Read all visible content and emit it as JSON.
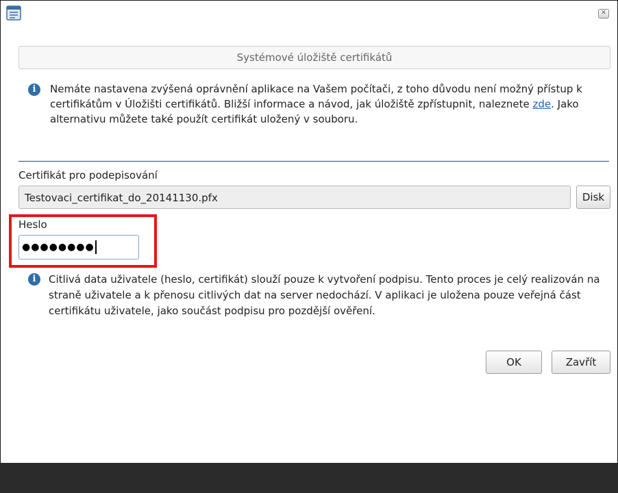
{
  "window": {
    "close_glyph": "✕"
  },
  "header": {
    "title": "Systémové úložiště certifikátů"
  },
  "notice": {
    "text_before_link": "Nemáte nastavena zvýšená oprávnění aplikace na Vašem počítači, z toho důvodu není možný přístup k certifikátům v Úložišti certifikátů. Bližší informace a návod, jak úložiště zpřístupnit, naleznete ",
    "link_text": "zde",
    "text_after_link": ". Jako alternativu můžete také použít certifikát uložený v souboru."
  },
  "certificate": {
    "label": "Certifikát pro podepisování",
    "value": "Testovaci_certifikat_do_20141130.pfx",
    "disk_button": "Disk"
  },
  "password": {
    "label": "Heslo",
    "masked_value": "●●●●●●●●"
  },
  "privacy_notice": {
    "text": "Citlivá data uživatele (heslo, certifikát) slouží pouze k vytvoření podpisu. Tento proces je celý realizován na straně uživatele a k přenosu citlivých dat na server nedochází. V aplikaci je uložena pouze veřejná část certifikátu uživatele, jako součást podpisu pro pozdější ověření."
  },
  "actions": {
    "ok_label": "OK",
    "close_label": "Zavřít"
  },
  "colors": {
    "accent": "#2f6ea8",
    "highlight": "#e3161b",
    "separator": "#2c4a73",
    "footer": "#2b2b2b"
  }
}
